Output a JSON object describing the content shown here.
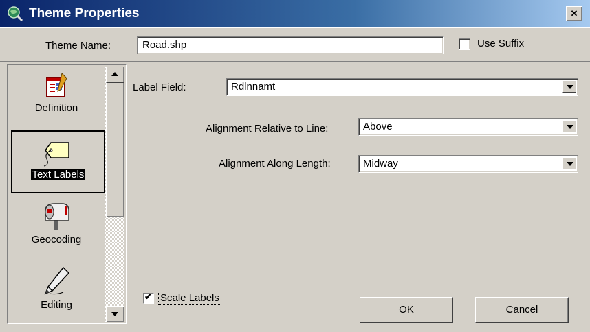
{
  "window": {
    "title": "Theme Properties",
    "close_glyph": "✕"
  },
  "theme_name": {
    "label": "Theme Name:",
    "value": "Road.shp"
  },
  "use_suffix": {
    "label": "Use Suffix",
    "checked": false
  },
  "sidebar": {
    "items": [
      {
        "label": "Definition",
        "icon": "definition-form-icon",
        "selected": false
      },
      {
        "label": "Text Labels",
        "icon": "tag-label-icon",
        "selected": true
      },
      {
        "label": "Geocoding",
        "icon": "mailbox-icon",
        "selected": false
      },
      {
        "label": "Editing",
        "icon": "pencil-icon",
        "selected": false
      }
    ]
  },
  "label_field": {
    "label": "Label Field:",
    "value": "Rdlnnamt"
  },
  "alignment_relative": {
    "label": "Alignment Relative to Line:",
    "value": "Above"
  },
  "alignment_length": {
    "label": "Alignment Along Length:",
    "value": "Midway"
  },
  "scale_labels": {
    "label": "Scale Labels",
    "checked": true,
    "check_glyph": "✔"
  },
  "buttons": {
    "ok": "OK",
    "cancel": "Cancel"
  },
  "colors": {
    "titlebar_start": "#0a246a",
    "titlebar_end": "#a6caf0",
    "face": "#d4d0c8"
  }
}
